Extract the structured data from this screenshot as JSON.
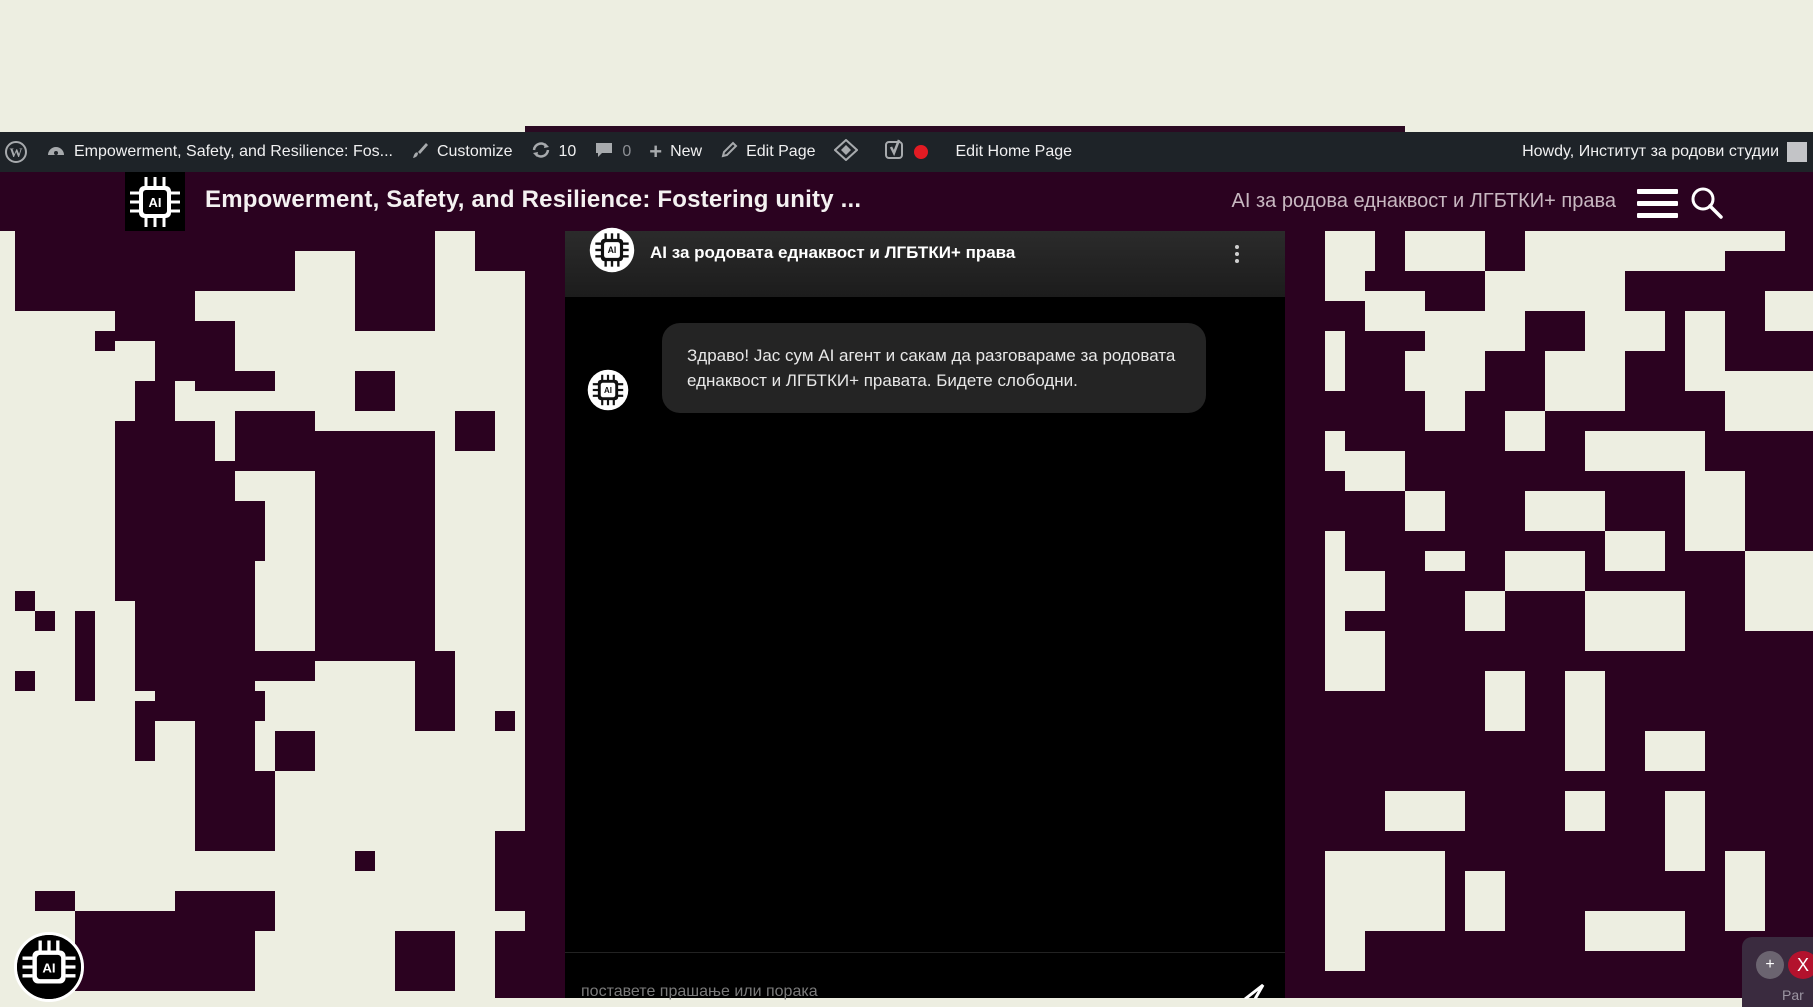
{
  "admin_bar": {
    "site_name": "Empowerment, Safety, and Resilience: Fos...",
    "customize": "Customize",
    "updates_count": "10",
    "comments_count": "0",
    "new_label": "New",
    "edit_page": "Edit Page",
    "edit_home_page": "Edit Home Page",
    "howdy": "Howdy, Институт за родови студии"
  },
  "header": {
    "logo_text": "AI",
    "site_title": "Empowerment, Safety, and Resilience: Fostering unity ...",
    "nav_link": "AI за родова еднаквост и ЛГБТКИ+ права"
  },
  "chat": {
    "title": "AI за родовата еднаквост и ЛГБТКИ+ права",
    "messages": [
      {
        "from": "bot",
        "text": "Здраво! Јас сум AI агент и сакам да разговараме за родовата еднаквост и ЛГБТКИ+ правата. Бидете слободни."
      }
    ],
    "input_placeholder": "поставете прашање или порака"
  },
  "widget": {
    "plus": "+",
    "close": "X",
    "label": "Par"
  },
  "colors": {
    "brand_dark": "#2b0220",
    "background_light": "#edeee1",
    "admin_bar": "#1e2328"
  }
}
